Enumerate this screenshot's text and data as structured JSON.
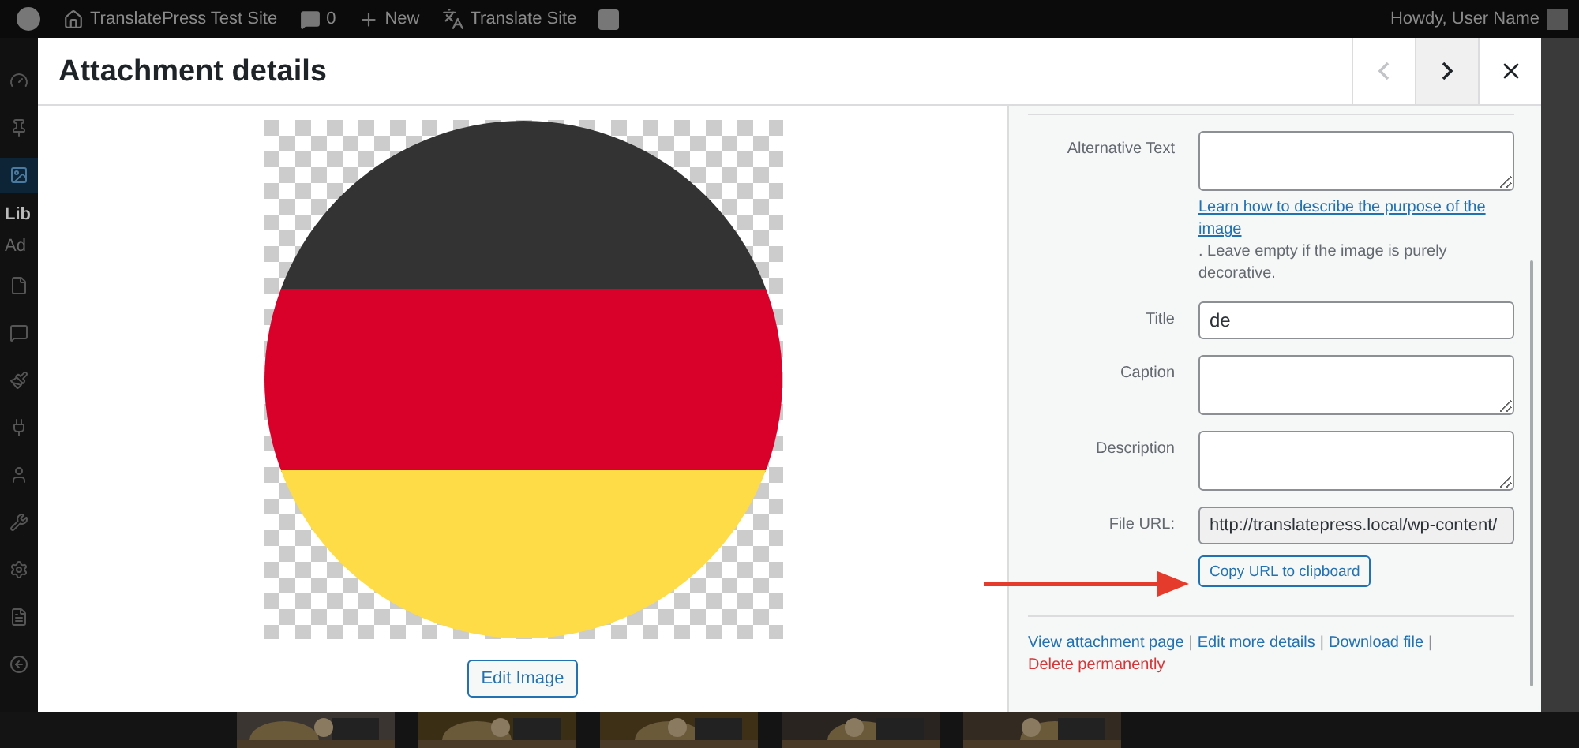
{
  "admin_bar": {
    "items": [
      {
        "kind": "logo"
      },
      {
        "kind": "home",
        "label": "TranslatePress Test Site"
      },
      {
        "kind": "comments",
        "label": "0"
      },
      {
        "kind": "new",
        "label": "New"
      },
      {
        "kind": "translate",
        "label": "Translate Site"
      },
      {
        "kind": "seo"
      }
    ],
    "greeting": "Howdy, User Name"
  },
  "sidebar": {
    "items": [
      {
        "kind": "dashboard",
        "selected": false
      },
      {
        "kind": "posts",
        "selected": false
      },
      {
        "kind": "media",
        "selected": true
      },
      {
        "kind": "text",
        "label": "Lib",
        "selected": true
      },
      {
        "kind": "text",
        "label": "Ad",
        "selected": false
      },
      {
        "kind": "pages",
        "selected": false
      },
      {
        "kind": "comments",
        "selected": false
      },
      {
        "kind": "appearance",
        "selected": false
      },
      {
        "kind": "plugins",
        "selected": false
      },
      {
        "kind": "users",
        "selected": false
      },
      {
        "kind": "tools",
        "selected": false
      },
      {
        "kind": "settings",
        "selected": false
      },
      {
        "kind": "seo",
        "selected": false
      },
      {
        "kind": "collapse",
        "selected": false
      }
    ]
  },
  "modal": {
    "title": "Attachment details",
    "nav": [
      {
        "kind": "prev",
        "disabled": true,
        "hovered": false
      },
      {
        "kind": "next",
        "disabled": false,
        "hovered": true
      },
      {
        "kind": "close",
        "disabled": false,
        "hovered": false
      }
    ],
    "preview": {
      "kind": "picture",
      "button": "Edit Image"
    },
    "fields": [
      {
        "kind": "textarea",
        "label": "Alternative Text",
        "help_link": "Learn how to describe the purpose of the image",
        "help": ". Leave empty if the image is purely decorative."
      },
      {
        "kind": "input",
        "label": "Title",
        "value": "de"
      },
      {
        "kind": "textarea",
        "label": "Caption"
      },
      {
        "kind": "textarea",
        "label": "Description"
      },
      {
        "kind": "readonly",
        "label": "File URL:",
        "value": "http://translatepress.local/wp-content/",
        "button": "Copy URL to clipboard"
      }
    ],
    "actions": [
      {
        "kind": "link",
        "label": "View attachment page"
      },
      {
        "kind": "separator",
        "label": "|"
      },
      {
        "kind": "link",
        "label": "Edit more details"
      },
      {
        "kind": "separator",
        "label": "|"
      },
      {
        "kind": "link",
        "label": "Download file"
      },
      {
        "kind": "separator",
        "label": "|"
      },
      {
        "kind": "delete",
        "label": "Delete permanently"
      }
    ]
  }
}
